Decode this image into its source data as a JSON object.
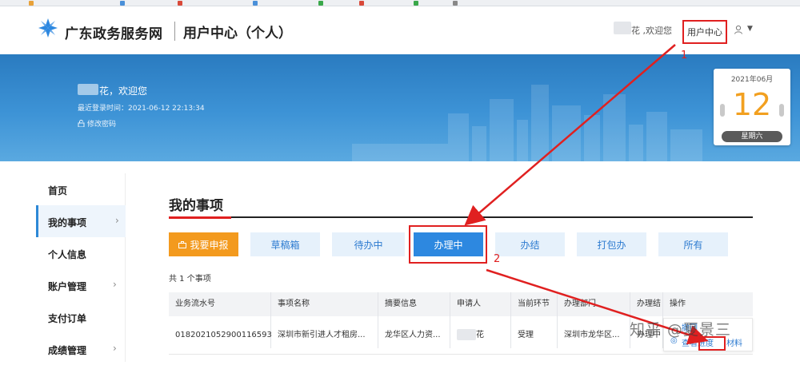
{
  "header": {
    "site_name": "广东政务服务网",
    "section_title": "用户中心（个人）",
    "welcome": "花 ,欢迎您",
    "user_center_link": "用户中心"
  },
  "banner": {
    "welcome": "花，欢迎您",
    "last_login": "最近登录时间：2021-06-12 22:13:34",
    "change_password": "修改密码"
  },
  "calendar": {
    "month": "2021年06月",
    "day": "12",
    "weekday": "星期六"
  },
  "sidebar": {
    "items": [
      {
        "label": "首页",
        "has_chevron": false
      },
      {
        "label": "我的事项",
        "has_chevron": true,
        "active": true
      },
      {
        "label": "个人信息",
        "has_chevron": false
      },
      {
        "label": "账户管理",
        "has_chevron": true
      },
      {
        "label": "支付订单",
        "has_chevron": false
      },
      {
        "label": "成绩管理",
        "has_chevron": true
      }
    ]
  },
  "main": {
    "title": "我的事项",
    "tabs": [
      {
        "label": "我要申报",
        "style": "primary"
      },
      {
        "label": "草稿箱"
      },
      {
        "label": "待办中"
      },
      {
        "label": "办理中",
        "active": true
      },
      {
        "label": "办结"
      },
      {
        "label": "打包办"
      },
      {
        "label": "所有"
      }
    ],
    "count_text": "共 1 个事项",
    "table": {
      "headers": [
        "业务流水号",
        "事项名称",
        "摘要信息",
        "申请人",
        "当前环节",
        "办理部门",
        "办理结",
        "操作"
      ],
      "rows": [
        [
          "0182021052900116593",
          "深圳市新引进人才租房...",
          "龙华区人力资...",
          "花",
          "受理",
          "深圳市龙华区...",
          "办理中",
          ""
        ]
      ],
      "operations": [
        "撤回",
        "查看进度",
        "材料"
      ]
    }
  },
  "annotations": {
    "step1": "1",
    "step2": "2",
    "watermark": "知乎 @夏景三"
  },
  "colors": {
    "brand_blue": "#2d88e0",
    "orange": "#f39a1e",
    "annotation_red": "#e02020"
  }
}
